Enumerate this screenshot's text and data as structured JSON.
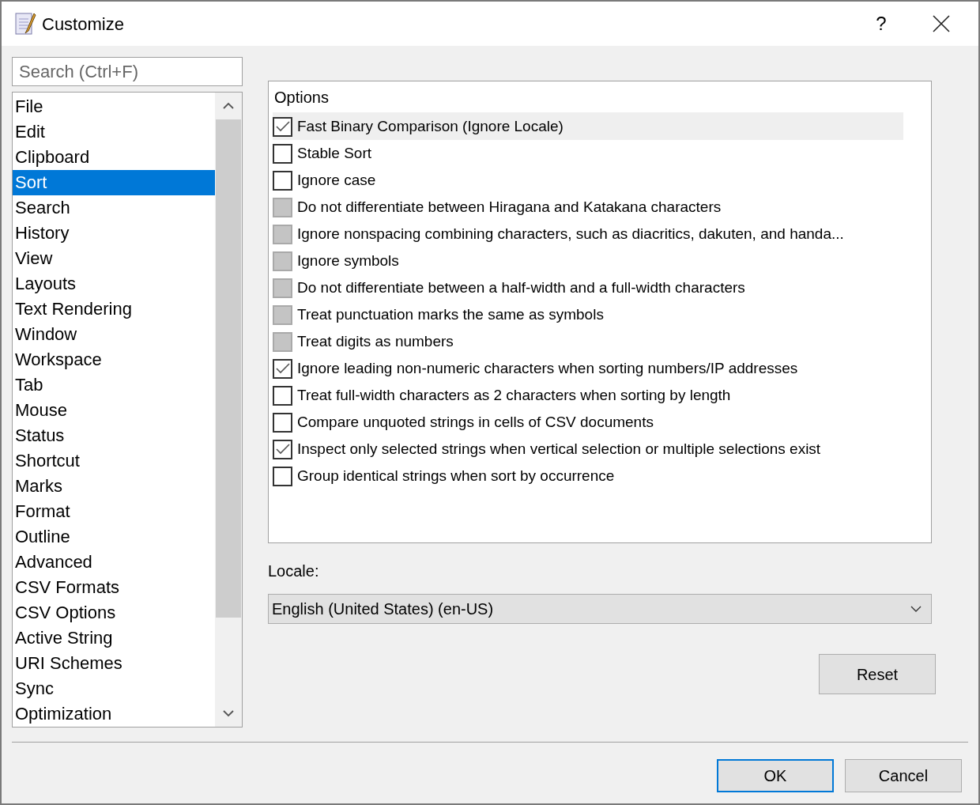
{
  "window": {
    "title": "Customize",
    "help": "?"
  },
  "search": {
    "placeholder": "Search (Ctrl+F)"
  },
  "categories": [
    {
      "label": "File",
      "selected": false
    },
    {
      "label": "Edit",
      "selected": false
    },
    {
      "label": "Clipboard",
      "selected": false
    },
    {
      "label": "Sort",
      "selected": true
    },
    {
      "label": "Search",
      "selected": false
    },
    {
      "label": "History",
      "selected": false
    },
    {
      "label": "View",
      "selected": false
    },
    {
      "label": "Layouts",
      "selected": false
    },
    {
      "label": "Text Rendering",
      "selected": false
    },
    {
      "label": "Window",
      "selected": false
    },
    {
      "label": "Workspace",
      "selected": false
    },
    {
      "label": "Tab",
      "selected": false
    },
    {
      "label": "Mouse",
      "selected": false
    },
    {
      "label": "Status",
      "selected": false
    },
    {
      "label": "Shortcut",
      "selected": false
    },
    {
      "label": "Marks",
      "selected": false
    },
    {
      "label": "Format",
      "selected": false
    },
    {
      "label": "Outline",
      "selected": false
    },
    {
      "label": "Advanced",
      "selected": false
    },
    {
      "label": "CSV Formats",
      "selected": false
    },
    {
      "label": "CSV Options",
      "selected": false
    },
    {
      "label": "Active String",
      "selected": false
    },
    {
      "label": "URI Schemes",
      "selected": false
    },
    {
      "label": "Sync",
      "selected": false
    },
    {
      "label": "Optimization",
      "selected": false
    }
  ],
  "options": {
    "header": "Options",
    "items": [
      {
        "label": "Fast Binary Comparison (Ignore Locale)",
        "checked": true,
        "disabled": false,
        "selected": true
      },
      {
        "label": "Stable Sort",
        "checked": false,
        "disabled": false,
        "selected": false
      },
      {
        "label": "Ignore case",
        "checked": false,
        "disabled": false,
        "selected": false
      },
      {
        "label": "Do not differentiate between Hiragana and Katakana characters",
        "checked": false,
        "disabled": true,
        "selected": false
      },
      {
        "label": "Ignore nonspacing combining characters, such as diacritics, dakuten, and handa...",
        "checked": false,
        "disabled": true,
        "selected": false
      },
      {
        "label": "Ignore symbols",
        "checked": false,
        "disabled": true,
        "selected": false
      },
      {
        "label": "Do not differentiate between a half-width and a full-width characters",
        "checked": false,
        "disabled": true,
        "selected": false
      },
      {
        "label": "Treat punctuation marks the same as symbols",
        "checked": false,
        "disabled": true,
        "selected": false
      },
      {
        "label": "Treat digits as numbers",
        "checked": false,
        "disabled": true,
        "selected": false
      },
      {
        "label": "Ignore leading non-numeric characters when sorting numbers/IP addresses",
        "checked": true,
        "disabled": false,
        "selected": false
      },
      {
        "label": "Treat full-width characters as 2 characters when sorting by length",
        "checked": false,
        "disabled": false,
        "selected": false
      },
      {
        "label": "Compare unquoted strings in cells of CSV documents",
        "checked": false,
        "disabled": false,
        "selected": false
      },
      {
        "label": "Inspect only selected strings when vertical selection or multiple selections exist",
        "checked": true,
        "disabled": false,
        "selected": false
      },
      {
        "label": "Group identical strings when sort by occurrence",
        "checked": false,
        "disabled": false,
        "selected": false
      }
    ]
  },
  "locale": {
    "label": "Locale:",
    "value": "English (United States) (en-US)"
  },
  "buttons": {
    "reset": "Reset",
    "ok": "OK",
    "cancel": "Cancel"
  }
}
